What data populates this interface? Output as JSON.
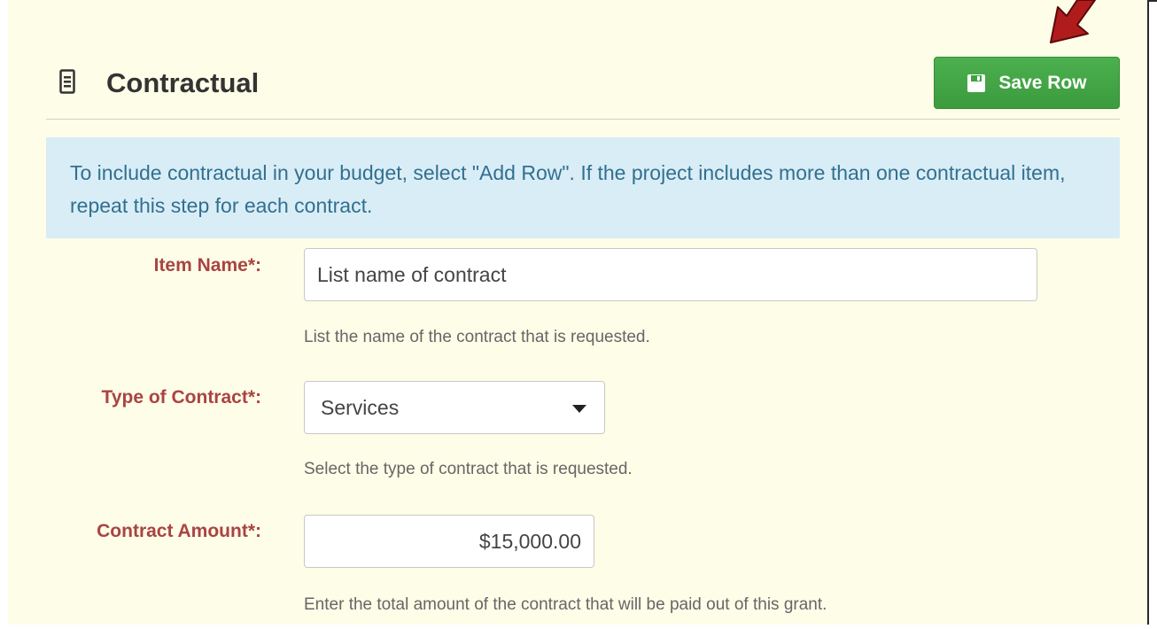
{
  "section": {
    "title": "Contractual",
    "save_button_label": "Save Row"
  },
  "alert": {
    "text": "To include contractual in your budget, select \"Add Row\". If the project includes more than one contractual item, repeat this step for each contract."
  },
  "form": {
    "item_name": {
      "label": "Item Name*:",
      "value": "List name of contract",
      "help": "List the name of the contract that is requested."
    },
    "contract_type": {
      "label": "Type of Contract*:",
      "selected": "Services",
      "help": "Select the type of contract that is requested."
    },
    "contract_amount": {
      "label": "Contract Amount*:",
      "value": "$15,000.00",
      "help": "Enter the total amount of the contract that will be paid out of this grant."
    }
  },
  "colors": {
    "panel_bg": "#fefde8",
    "accent_green": "#45a847",
    "required_label": "#a94442",
    "alert_bg": "#d9edf7",
    "alert_text": "#31708f",
    "annotation_arrow": "#b01c1c"
  },
  "icons": {
    "title_icon": "document-list-icon",
    "save_icon": "floppy-disk-icon",
    "select_icon": "caret-down-icon",
    "annotation": "red-arrow-icon"
  }
}
